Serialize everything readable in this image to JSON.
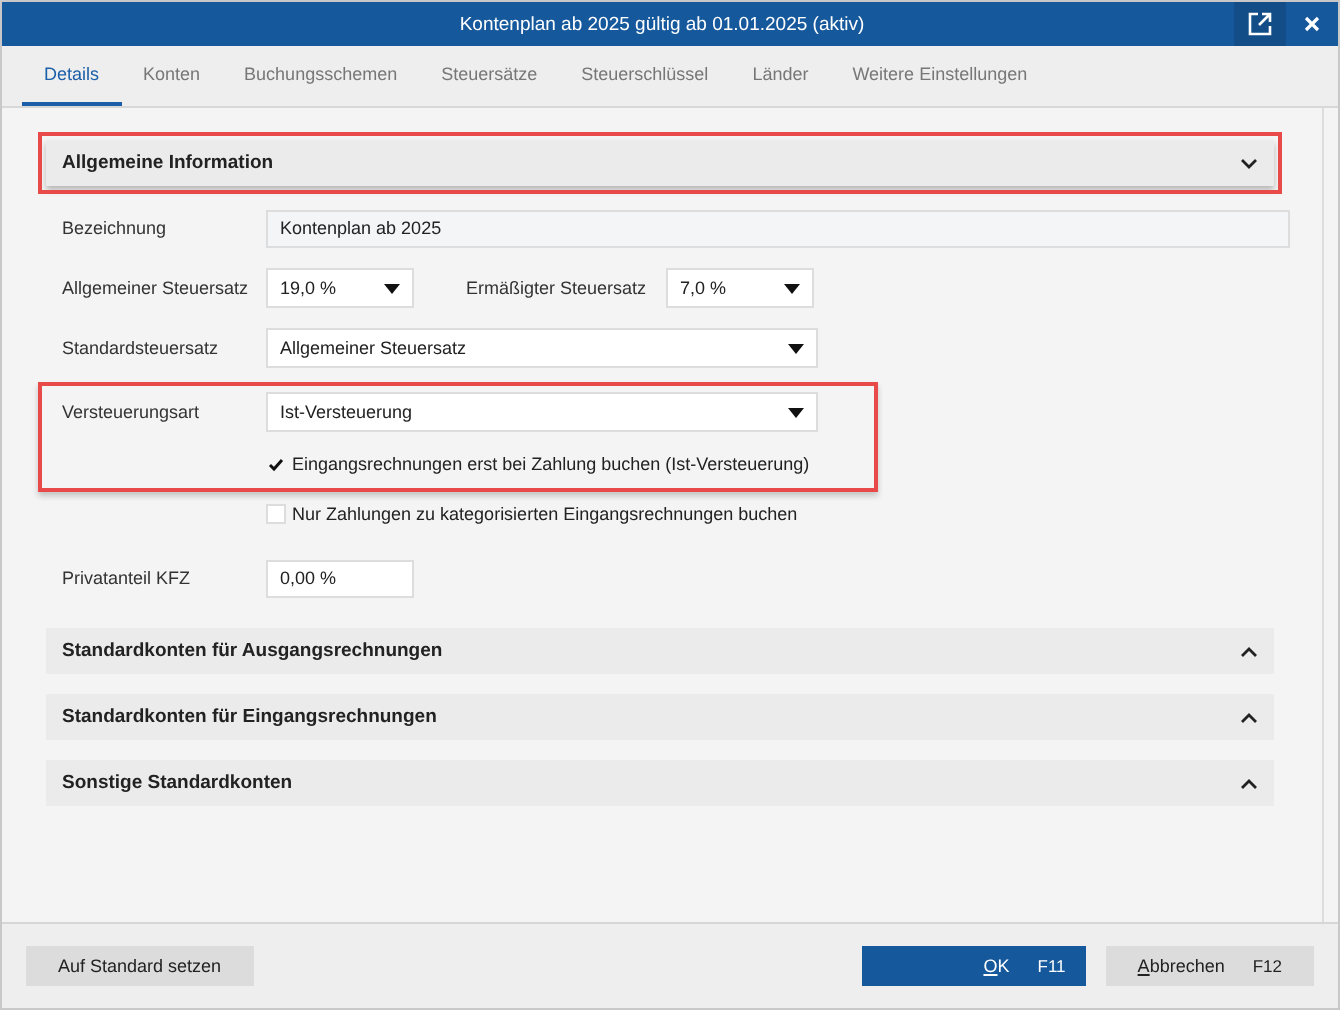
{
  "window": {
    "title": "Kontenplan ab 2025 gültig ab 01.01.2025 (aktiv)"
  },
  "tabs": [
    {
      "label": "Details",
      "selected": true
    },
    {
      "label": "Konten",
      "selected": false
    },
    {
      "label": "Buchungsschemen",
      "selected": false
    },
    {
      "label": "Steuersätze",
      "selected": false
    },
    {
      "label": "Steuerschlüssel",
      "selected": false
    },
    {
      "label": "Länder",
      "selected": false
    },
    {
      "label": "Weitere Einstellungen",
      "selected": false
    }
  ],
  "sections": [
    {
      "title": "Allgemeine Information",
      "expanded": true,
      "highlighted": true,
      "rows": [
        {
          "kind": "text",
          "label": "Bezeichnung",
          "value": "Kontenplan ab 2025",
          "readonly": true
        },
        {
          "kind": "select_pair",
          "label": "Allgemeiner Steuersatz",
          "value": "19,0 %",
          "label_2": "Ermäßigter Steuersatz",
          "value_2": "7,0 %"
        },
        {
          "kind": "select",
          "label": "Standardsteuersatz",
          "value": "Allgemeiner Steuersatz"
        },
        {
          "kind": "select",
          "label": "Versteuerungsart",
          "value": "Ist-Versteuerung",
          "highlighted": true,
          "checkbox": {
            "label": "Eingangsrechnungen erst bei Zahlung buchen (Ist-Versteuerung)",
            "checked": true
          }
        },
        {
          "kind": "checkbox",
          "label": "Nur Zahlungen zu kategorisierten Eingangsrechnungen buchen",
          "checked": false
        },
        {
          "kind": "input",
          "label": "Privatanteil KFZ",
          "value": "0,00 %"
        }
      ]
    },
    {
      "title": "Standardkonten für Ausgangsrechnungen",
      "expanded": false,
      "highlighted": false
    },
    {
      "title": "Standardkonten für Eingangsrechnungen",
      "expanded": false,
      "highlighted": false
    },
    {
      "title": "Sonstige Standardkonten",
      "expanded": false,
      "highlighted": false
    }
  ],
  "footer": {
    "left_button": "Auf Standard setzen",
    "buttons": [
      {
        "label": "OK",
        "key": "F11",
        "primary": true
      },
      {
        "label": "Abbrechen",
        "key": "F12",
        "primary": false
      }
    ]
  }
}
